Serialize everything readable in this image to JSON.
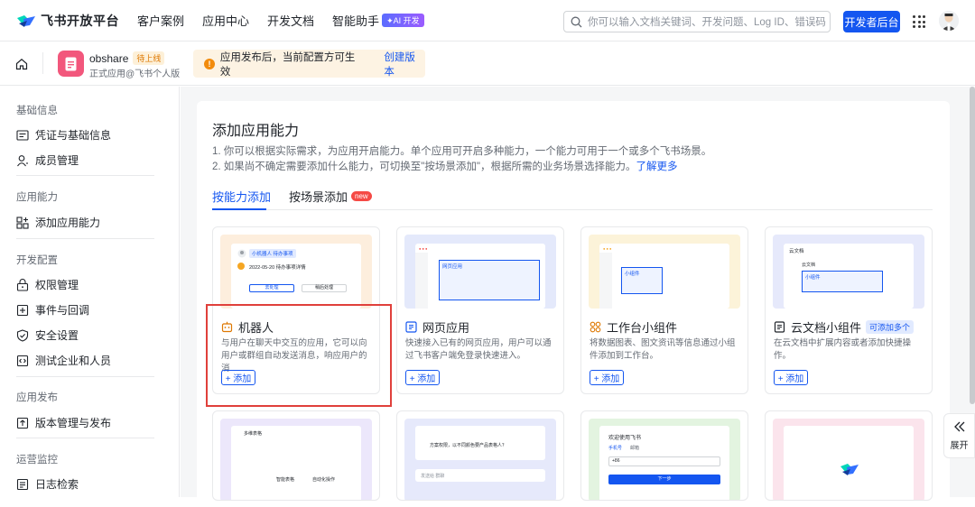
{
  "header": {
    "brand": "飞书开放平台",
    "nav": [
      "客户案例",
      "应用中心",
      "开发文档",
      "智能助手"
    ],
    "ai_badge": "✦AI 开发",
    "search_placeholder": "你可以输入文档关键词、开发问题、Log ID、错误码",
    "dev_button": "开发者后台"
  },
  "app": {
    "name": "obshare",
    "status": "待上线",
    "subtitle": "正式应用@飞书个人版",
    "notice": "应用发布后，当前配置方可生效",
    "notice_link": "创建版本"
  },
  "sidebar": {
    "groups": [
      {
        "title": "基础信息",
        "items": [
          "凭证与基础信息",
          "成员管理"
        ]
      },
      {
        "title": "应用能力",
        "items": [
          "添加应用能力"
        ]
      },
      {
        "title": "开发配置",
        "items": [
          "权限管理",
          "事件与回调",
          "安全设置",
          "测试企业和人员"
        ]
      },
      {
        "title": "应用发布",
        "items": [
          "版本管理与发布"
        ]
      },
      {
        "title": "运营监控",
        "items": [
          "日志检索"
        ]
      }
    ]
  },
  "main": {
    "title": "添加应用能力",
    "desc1": "1. 你可以根据实际需求，为应用开启能力。单个应用可开启多种能力，一个能力可用于一个或多个飞书场景。",
    "desc2": "2. 如果尚不确定需要添加什么能力，可切换至\"按场景添加\"，根据所需的业务场景选择能力。",
    "learn_more": "了解更多",
    "tabs": [
      "按能力添加",
      "按场景添加"
    ],
    "new_badge": "new",
    "add_label": "+ 添加",
    "cards": [
      {
        "title": "机器人",
        "desc": "与用户在聊天中交互的应用，它可以向用户或群组自动发送消息，响应用户的消...",
        "preview_bg": "#fdeedd"
      },
      {
        "title": "网页应用",
        "desc": "快速接入已有的网页应用，用户可以通过飞书客户端免登录快速进入。",
        "preview_bg": "#e4e9fb"
      },
      {
        "title": "工作台小组件",
        "desc": "将数据图表、图文资讯等信息通过小组件添加到工作台。",
        "preview_bg": "#fcf3d9"
      },
      {
        "title": "云文档小组件",
        "badge": "可添加多个",
        "desc": "在云文档中扩展内容或者添加快捷操作。",
        "preview_bg": "#e6e9fb"
      }
    ],
    "robot_preview": {
      "chip": "小机器人 待办事项",
      "line": "2022-05-20 待办事项详情",
      "btn1": "去处理",
      "btn2": "稍后处理"
    },
    "web_preview": {
      "label": "网页应用"
    },
    "widget_preview": {
      "label": "小组件"
    },
    "doc_preview": {
      "header": "云文档",
      "sub": "云文档",
      "label": "小组件"
    },
    "bottom_previews": [
      {
        "bg": "#ece7fb",
        "label1": "智能表格",
        "label2": "自动化操作",
        "top": "多维表格"
      },
      {
        "bg": "#e6e9fb",
        "line1": "方案权限，以不同颜色要产品表格人？",
        "input": "发送给 群聊"
      },
      {
        "bg": "#e3f4e0",
        "title": "欢迎使用飞书",
        "tab1": "手机号",
        "tab2": "邮箱",
        "code": "+86",
        "btn": "下一步"
      },
      {
        "bg": "#fbe4ec"
      }
    ]
  },
  "expand_label": "展开",
  "colors": {
    "primary": "#1456f0",
    "danger": "#e0403b",
    "warning": "#f28b0c"
  }
}
